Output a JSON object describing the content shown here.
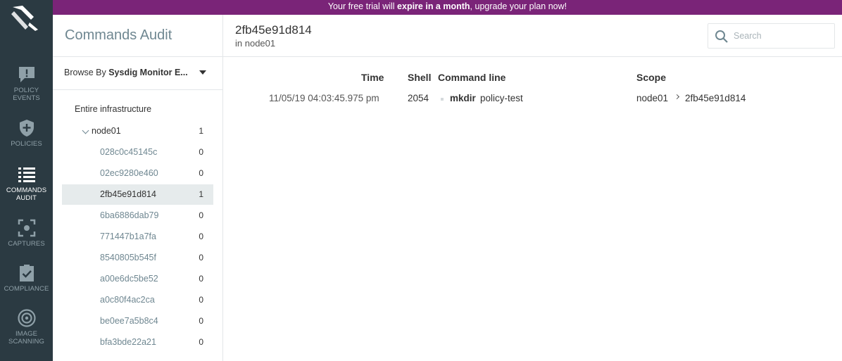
{
  "banner": {
    "prefix": "Your free trial will ",
    "bold": "expire in a month",
    "suffix": ", upgrade your plan now!"
  },
  "nav": {
    "items": [
      {
        "label": "Policy Events",
        "icon": "alert-bubble-icon",
        "active": false
      },
      {
        "label": "Policies",
        "icon": "shield-plus-icon",
        "active": false
      },
      {
        "label": "Commands Audit",
        "icon": "list-icon",
        "active": true
      },
      {
        "label": "Captures",
        "icon": "capture-focus-icon",
        "active": false
      },
      {
        "label": "Compliance",
        "icon": "clipboard-check-icon",
        "active": false
      },
      {
        "label": "Image Scanning",
        "icon": "radar-icon",
        "active": false
      }
    ]
  },
  "panel": {
    "title": "Commands Audit",
    "browse_prefix": "Browse By ",
    "browse_value": "Sysdig Monitor E...",
    "tree": {
      "root": "Entire infrastructure",
      "parent": {
        "label": "node01",
        "count": "1"
      },
      "children": [
        {
          "label": "028c0c45145c",
          "count": "0"
        },
        {
          "label": "02ec9280e460",
          "count": "0"
        },
        {
          "label": "2fb45e91d814",
          "count": "1",
          "selected": true
        },
        {
          "label": "6ba6886dab79",
          "count": "0"
        },
        {
          "label": "771447b1a7fa",
          "count": "0"
        },
        {
          "label": "8540805b545f",
          "count": "0"
        },
        {
          "label": "a00e6dc5be52",
          "count": "0"
        },
        {
          "label": "a0c80f4ac2ca",
          "count": "0"
        },
        {
          "label": "be0ee7a5b8c4",
          "count": "0"
        },
        {
          "label": "bfa3bde22a21",
          "count": "0"
        }
      ]
    }
  },
  "main": {
    "title": "2fb45e91d814",
    "subtitle": "in node01",
    "search_placeholder": "Search",
    "columns": {
      "time": "Time",
      "shell": "Shell",
      "command": "Command line",
      "scope": "Scope"
    },
    "rows": [
      {
        "time": "11/05/19 04:03:45.975 pm",
        "shell": "2054",
        "cmd_name": "mkdir",
        "cmd_args": "policy-test",
        "scope_host": "node01",
        "scope_container": "2fb45e91d814"
      }
    ]
  },
  "colors": {
    "nav_bg": "#2b3a42",
    "banner_bg": "#7a2478",
    "selected_row": "#e6ebec",
    "muted_text": "#6f8791"
  }
}
